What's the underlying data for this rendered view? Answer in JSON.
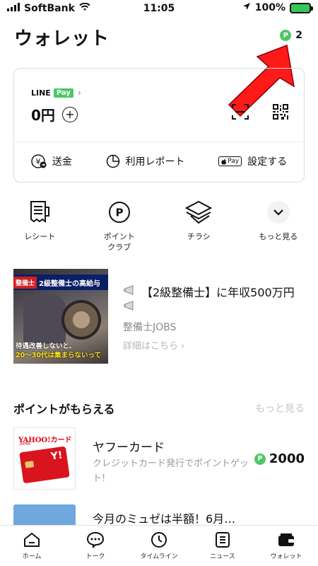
{
  "status_bar": {
    "carrier": "SoftBank",
    "time": "11:05",
    "battery": "100%"
  },
  "header": {
    "title": "ウォレット",
    "points_count": "2",
    "points_badge": "P"
  },
  "pay_card": {
    "brand_line": "LINE",
    "brand_pay": "Pay",
    "balance": "0円",
    "actions": [
      {
        "label": "送金",
        "icon": "yen-transfer-icon"
      },
      {
        "label": "利用レポート",
        "icon": "pie-chart-icon"
      },
      {
        "label": "設定する",
        "icon": "apple-pay-icon",
        "badge": "Pay"
      }
    ]
  },
  "quick_menu": [
    {
      "label": "レシート",
      "icon": "receipt-icon"
    },
    {
      "label": "ポイント\nクラブ",
      "icon": "point-club-icon"
    },
    {
      "label": "チラシ",
      "icon": "flyer-icon"
    },
    {
      "label": "もっと見る",
      "icon": "chevron-down-icon"
    }
  ],
  "ad": {
    "thumb_tag": "整備士",
    "thumb_banner": "2級整備士の高給与",
    "thumb_caption_1": "待遇改善しないと、",
    "thumb_caption_2": "20～30代は集まらないって",
    "title": "【2級整備士】に年収500万円",
    "sponsor": "整備士JOBS",
    "link": "詳細はこちら ›"
  },
  "points_section": {
    "title": "ポイントがもらえる",
    "more": "もっと見る",
    "offers": [
      {
        "name": "ヤフーカード",
        "description": "クレジットカード発行でポイントゲット!",
        "points": "2000",
        "logo_text": "YAHOO!カード",
        "logo_sub": "JAPAN"
      },
      {
        "name": "今月のミュゼは半額！6月…"
      }
    ]
  },
  "tabbar": [
    {
      "label": "ホーム",
      "icon": "home-icon"
    },
    {
      "label": "トーク",
      "icon": "chat-icon"
    },
    {
      "label": "タイムライン",
      "icon": "clock-icon"
    },
    {
      "label": "ニュース",
      "icon": "news-icon"
    },
    {
      "label": "ウォレット",
      "icon": "wallet-icon"
    }
  ],
  "colors": {
    "line_green": "#4cc764",
    "arrow_red": "#ff1a1a",
    "card_border": "#dcdcdc",
    "muted_text": "#999999"
  }
}
